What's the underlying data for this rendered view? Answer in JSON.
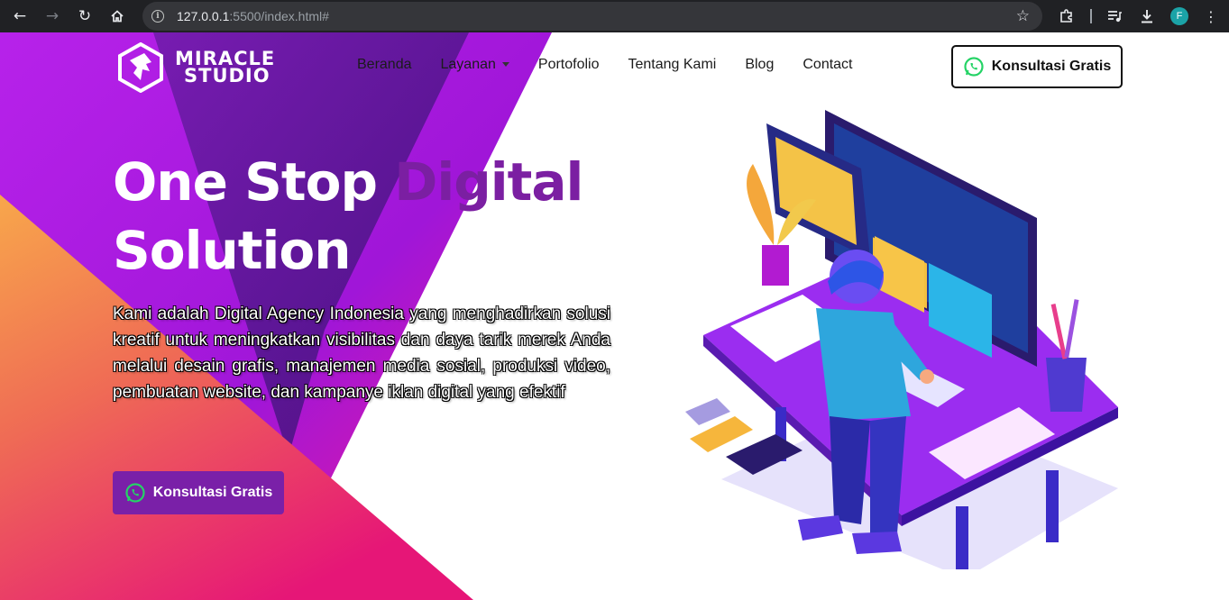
{
  "browser": {
    "url_host": "127.0.0.1",
    "url_rest": ":5500/index.html#",
    "profile_initial": "F",
    "icons": [
      "back-icon",
      "forward-icon",
      "reload-icon",
      "home-icon",
      "site-info-icon",
      "bookmark-star-icon",
      "extensions-icon",
      "media-queue-icon",
      "download-icon",
      "profile-avatar",
      "menu-kebab-icon"
    ]
  },
  "brand": {
    "line1": "MIRACLE",
    "line2": "STUDIO"
  },
  "nav": {
    "items": [
      {
        "label": "Beranda"
      },
      {
        "label": "Layanan"
      },
      {
        "label": "Portofolio"
      },
      {
        "label": "Tentang Kami"
      },
      {
        "label": "Blog"
      },
      {
        "label": "Contact"
      }
    ],
    "cta_label": "Konsultasi Gratis"
  },
  "hero": {
    "title_part1": "One Stop ",
    "title_accent": "Digital",
    "title_part2": "Solution",
    "description": "Kami adalah Digital Agency Indonesia yang menghadirkan solusi kreatif untuk meningkatkan visibilitas dan daya tarik merek Anda melalui desain grafis, manajemen media sosial, produksi video, pembuatan website, dan kampanye iklan digital yang efektif",
    "cta_label": "Konsultasi Gratis"
  },
  "colors": {
    "accent": "#7b1fa2",
    "cta_bg": "#7a20a8",
    "whatsapp": "#25d366",
    "gradient_purple": "#b721e8",
    "gradient_pink": "#e6138f",
    "gradient_orange": "#f6a04d"
  }
}
